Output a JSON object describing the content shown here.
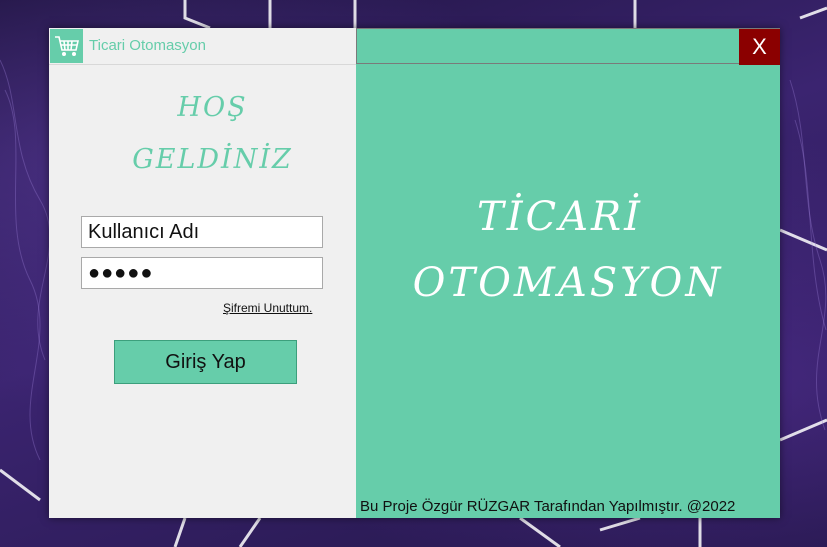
{
  "window": {
    "title": "Ticari Otomasyon",
    "close_label": "X",
    "colors": {
      "accent": "#66cdaa",
      "close_bg": "#8b0000",
      "left_bg": "#f0f0f0"
    }
  },
  "login": {
    "welcome_line1": "HOŞ",
    "welcome_line2": "GELDİNİZ",
    "username_value": "Kullanıcı Adı",
    "password_value": "●●●●●",
    "forgot_link": "Şifremi Unuttum.",
    "submit_label": "Giriş Yap"
  },
  "banner": {
    "line1": "TİCARİ",
    "line2": "OTOMASYON",
    "footer": "Bu Proje Özgür RÜZGAR Tarafından Yapılmıştır. @2022"
  },
  "icons": {
    "app": "shopping-cart-icon"
  }
}
